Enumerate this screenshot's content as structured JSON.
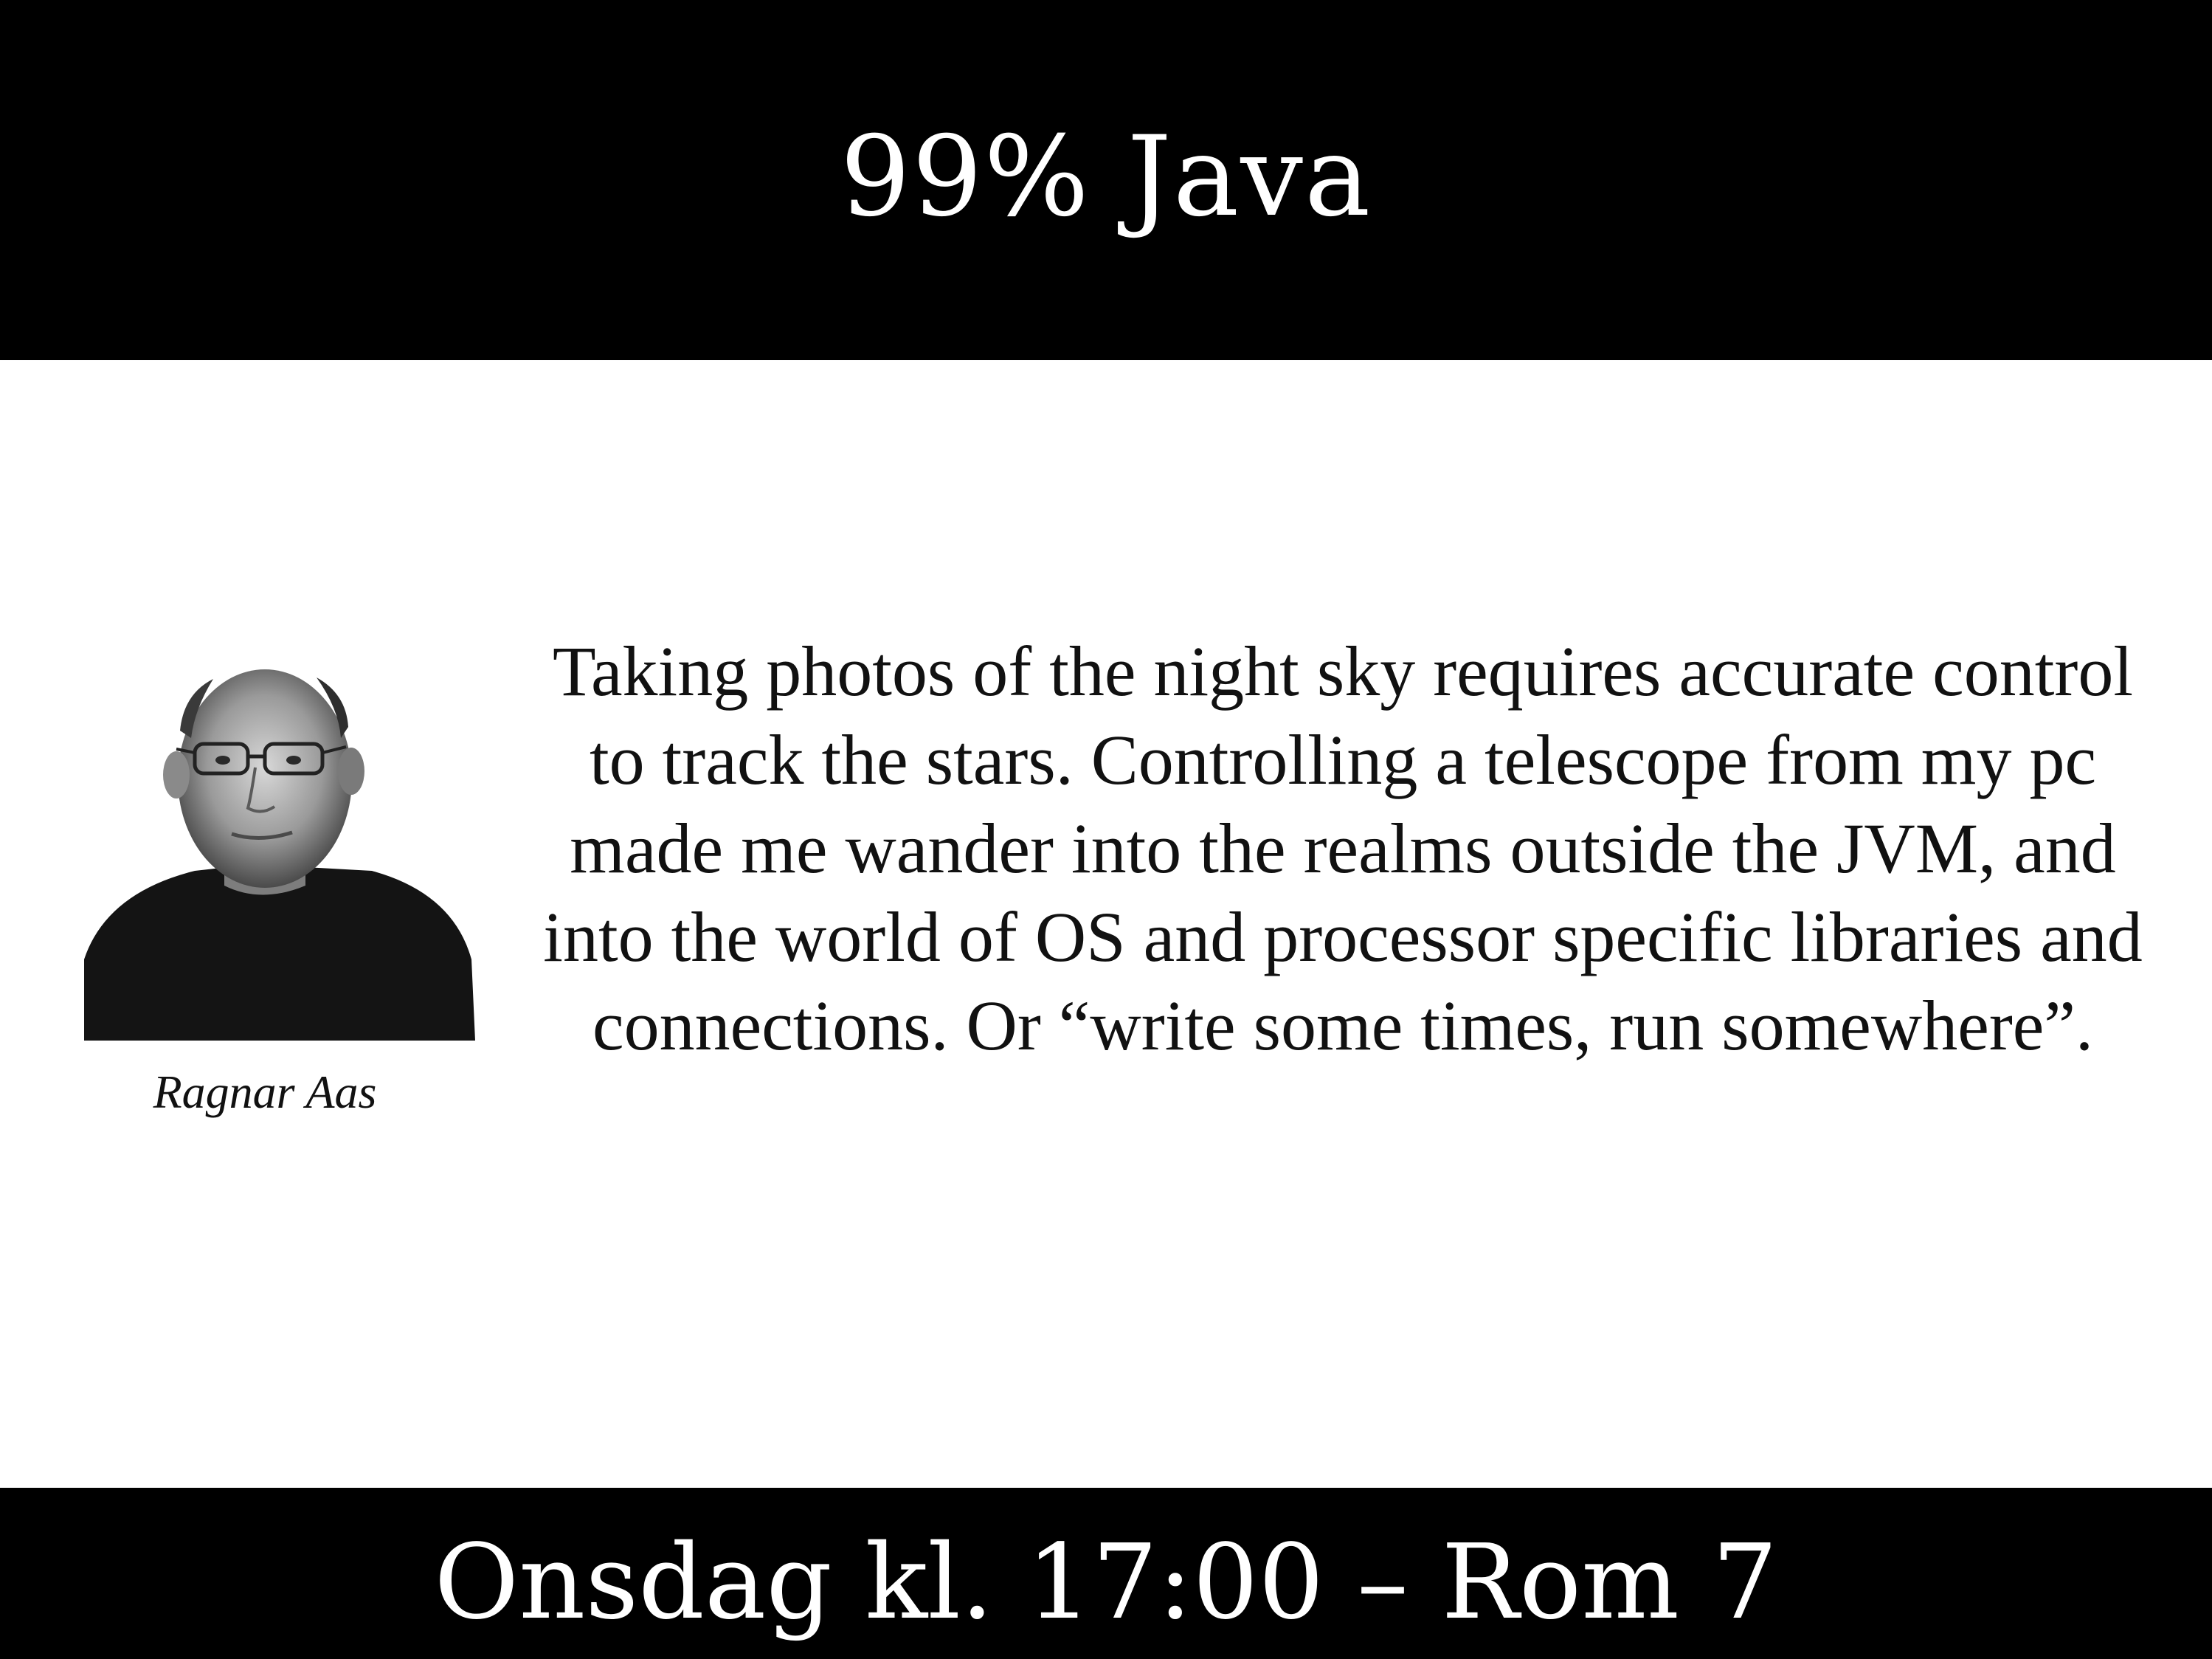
{
  "slide": {
    "title": "99% Java",
    "speaker": {
      "name": "Ragnar Aas",
      "photo": "speaker-portrait-photo"
    },
    "abstract": "Taking photos of the night sky requires accurate control to track the stars. Controlling a telescope from my pc made me wander into the realms outside the JVM, and into the world of OS and processor specific libraries and connections. Or “write some times, run somewhere”.",
    "footer": "Onsdag kl. 17:00 – Rom 7"
  },
  "colors": {
    "band": "#000000",
    "band_text": "#ffffff",
    "body_text": "#111111",
    "background": "#ffffff"
  }
}
